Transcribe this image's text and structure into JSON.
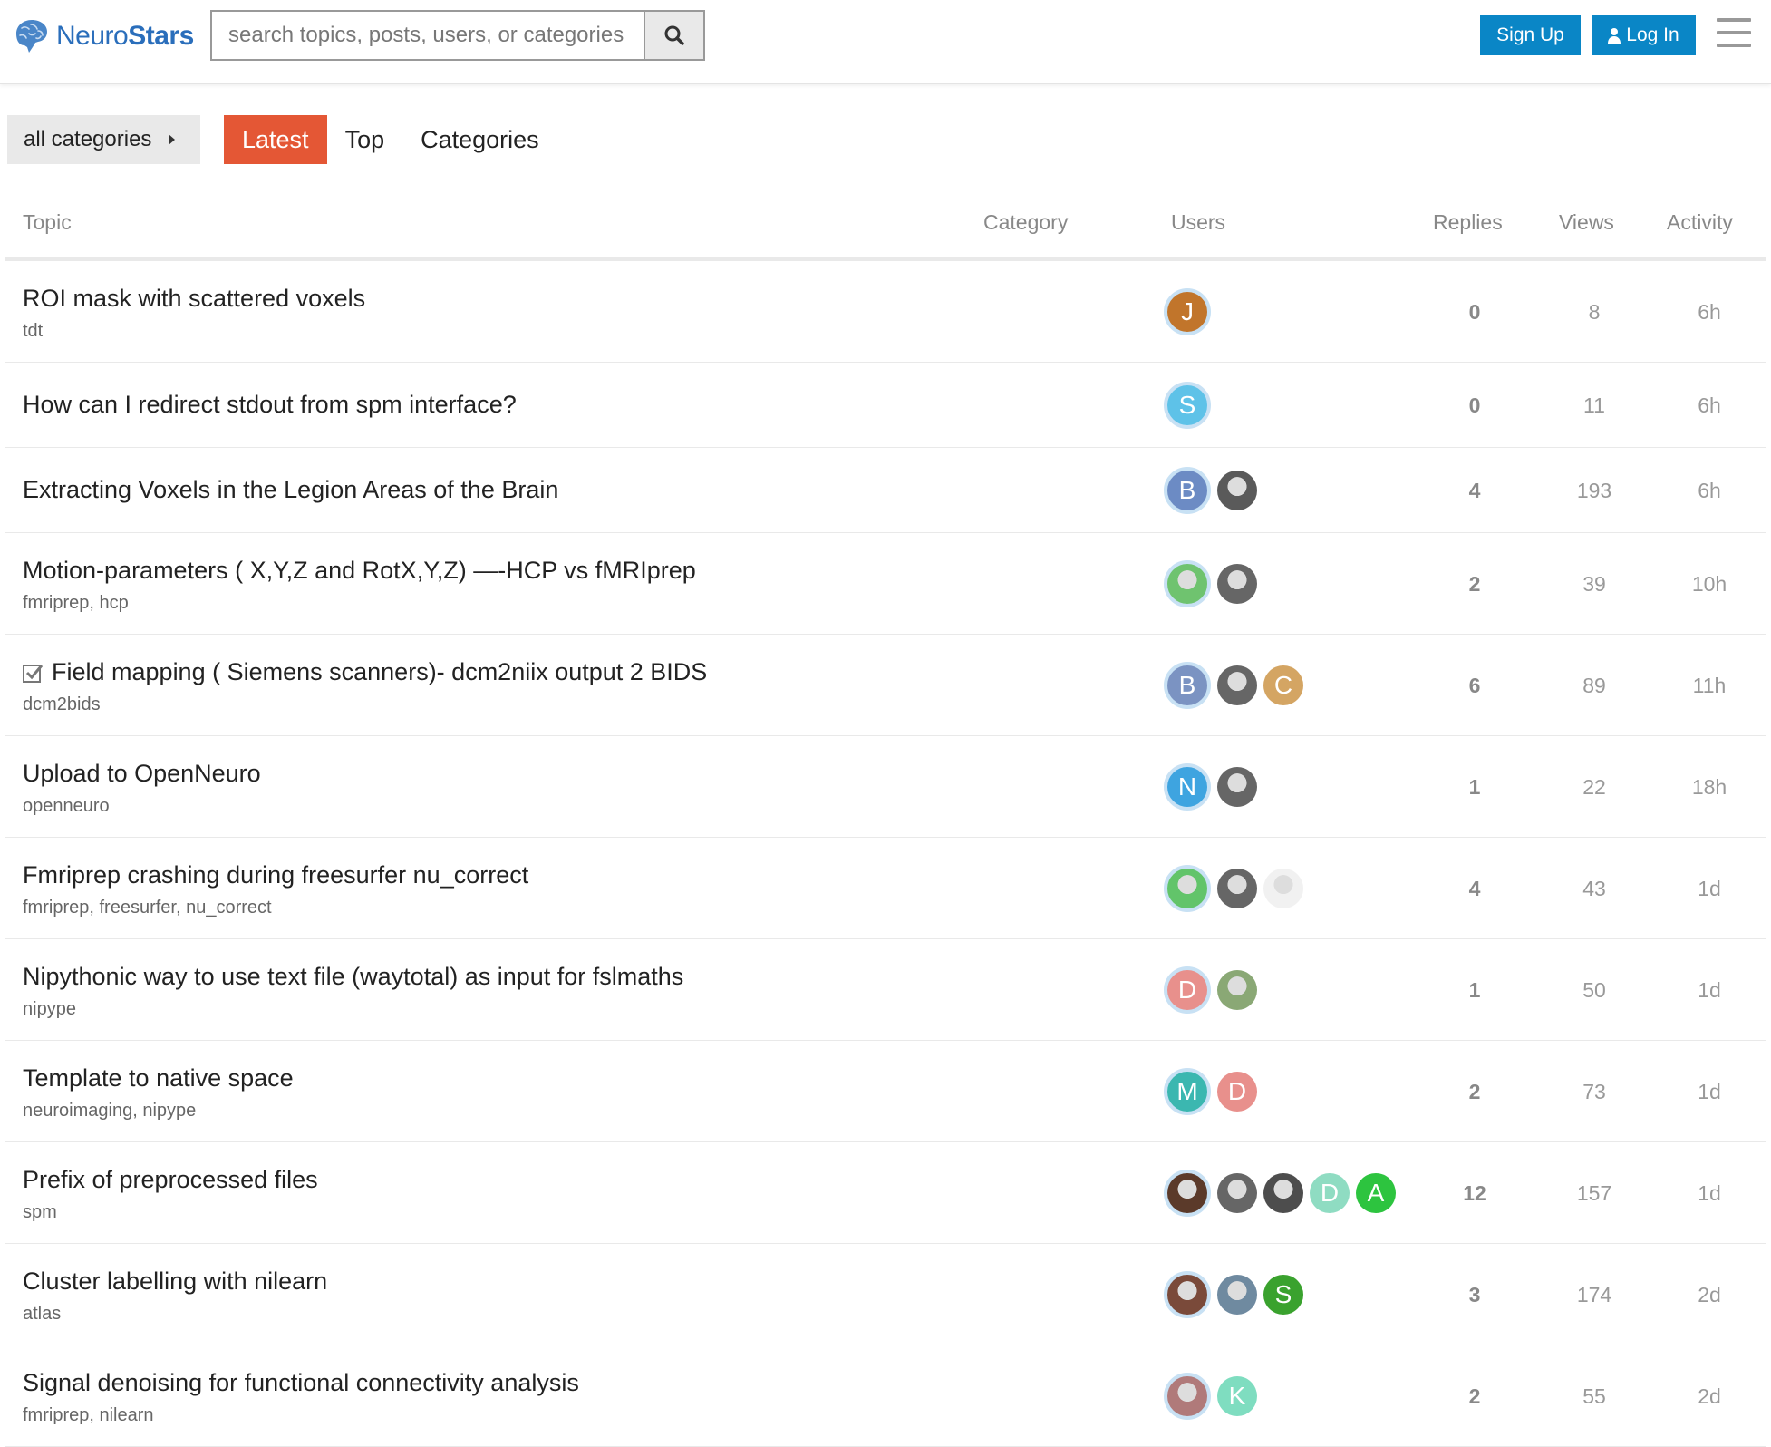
{
  "header": {
    "logo_text_a": "Neuro",
    "logo_text_b": "Stars",
    "search_placeholder": "search topics, posts, users, or categories",
    "signup_label": "Sign Up",
    "login_label": "Log In"
  },
  "nav": {
    "category_dropdown": "all categories",
    "tabs": [
      {
        "label": "Latest",
        "active": true
      },
      {
        "label": "Top",
        "active": false
      },
      {
        "label": "Categories",
        "active": false
      }
    ]
  },
  "columns": {
    "topic": "Topic",
    "category": "Category",
    "users": "Users",
    "replies": "Replies",
    "views": "Views",
    "activity": "Activity"
  },
  "topics": [
    {
      "title": "ROI mask with scattered voxels",
      "tags": [
        "tdt"
      ],
      "users": [
        {
          "letter": "J",
          "color": "#c1752b"
        }
      ],
      "replies": "0",
      "views": "8",
      "activity": "6h"
    },
    {
      "title": "How can I redirect stdout from spm interface?",
      "tags": [],
      "users": [
        {
          "letter": "S",
          "color": "#5ec2e8"
        }
      ],
      "replies": "0",
      "views": "11",
      "activity": "6h"
    },
    {
      "title": "Extracting Voxels in the Legion Areas of the Brain",
      "tags": [],
      "users": [
        {
          "letter": "B",
          "color": "#6c8bc4"
        },
        {
          "letter": "",
          "color": "#5a5a5a"
        }
      ],
      "replies": "4",
      "views": "193",
      "activity": "6h"
    },
    {
      "title": "Motion-parameters ( X,Y,Z and RotX,Y,Z) —-HCP vs fMRIprep",
      "tags": [
        "fmriprep",
        "hcp"
      ],
      "users": [
        {
          "letter": "",
          "color": "#6fc36f"
        },
        {
          "letter": "",
          "color": "#666"
        }
      ],
      "replies": "2",
      "views": "39",
      "activity": "10h"
    },
    {
      "title": "Field mapping ( Siemens scanners)- dcm2niix output 2 BIDS",
      "solved": true,
      "tags": [
        "dcm2bids"
      ],
      "users": [
        {
          "letter": "B",
          "color": "#7b93c2"
        },
        {
          "letter": "",
          "color": "#666"
        },
        {
          "letter": "C",
          "color": "#d4a563"
        }
      ],
      "replies": "6",
      "views": "89",
      "activity": "11h"
    },
    {
      "title": "Upload to OpenNeuro",
      "tags": [
        "openneuro"
      ],
      "users": [
        {
          "letter": "N",
          "color": "#3ea4e0"
        },
        {
          "letter": "",
          "color": "#666"
        }
      ],
      "replies": "1",
      "views": "22",
      "activity": "18h"
    },
    {
      "title": "Fmriprep crashing during freesurfer nu_correct",
      "tags": [
        "fmriprep",
        "freesurfer",
        "nu_correct"
      ],
      "users": [
        {
          "letter": "",
          "color": "#62c46a"
        },
        {
          "letter": "",
          "color": "#666"
        },
        {
          "letter": "",
          "color": "#f1f1f1"
        }
      ],
      "replies": "4",
      "views": "43",
      "activity": "1d"
    },
    {
      "title": "Nipythonic way to use text file (waytotal) as input for fslmaths",
      "tags": [
        "nipype"
      ],
      "users": [
        {
          "letter": "D",
          "color": "#e8908c"
        },
        {
          "letter": "",
          "color": "#8aa875"
        }
      ],
      "replies": "1",
      "views": "50",
      "activity": "1d"
    },
    {
      "title": "Template to native space",
      "tags": [
        "neuroimaging",
        "nipype"
      ],
      "users": [
        {
          "letter": "M",
          "color": "#3bb7b0"
        },
        {
          "letter": "D",
          "color": "#e8908c"
        }
      ],
      "replies": "2",
      "views": "73",
      "activity": "1d"
    },
    {
      "title": "Prefix of preprocessed files",
      "tags": [
        "spm"
      ],
      "users": [
        {
          "letter": "",
          "color": "#5b3a2a"
        },
        {
          "letter": "",
          "color": "#666"
        },
        {
          "letter": "",
          "color": "#4d4d4d"
        },
        {
          "letter": "D",
          "color": "#8fdcc2"
        },
        {
          "letter": "A",
          "color": "#2dc43f"
        }
      ],
      "replies": "12",
      "views": "157",
      "activity": "1d"
    },
    {
      "title": "Cluster labelling with nilearn",
      "tags": [
        "atlas"
      ],
      "users": [
        {
          "letter": "",
          "color": "#7a4a3a"
        },
        {
          "letter": "",
          "color": "#6f8aa0"
        },
        {
          "letter": "S",
          "color": "#3aa22e"
        }
      ],
      "replies": "3",
      "views": "174",
      "activity": "2d"
    },
    {
      "title": "Signal denoising for functional connectivity analysis",
      "tags": [
        "fmriprep",
        "nilearn"
      ],
      "users": [
        {
          "letter": "",
          "color": "#b07a7a"
        },
        {
          "letter": "K",
          "color": "#7fddc0"
        }
      ],
      "replies": "2",
      "views": "55",
      "activity": "2d"
    }
  ]
}
